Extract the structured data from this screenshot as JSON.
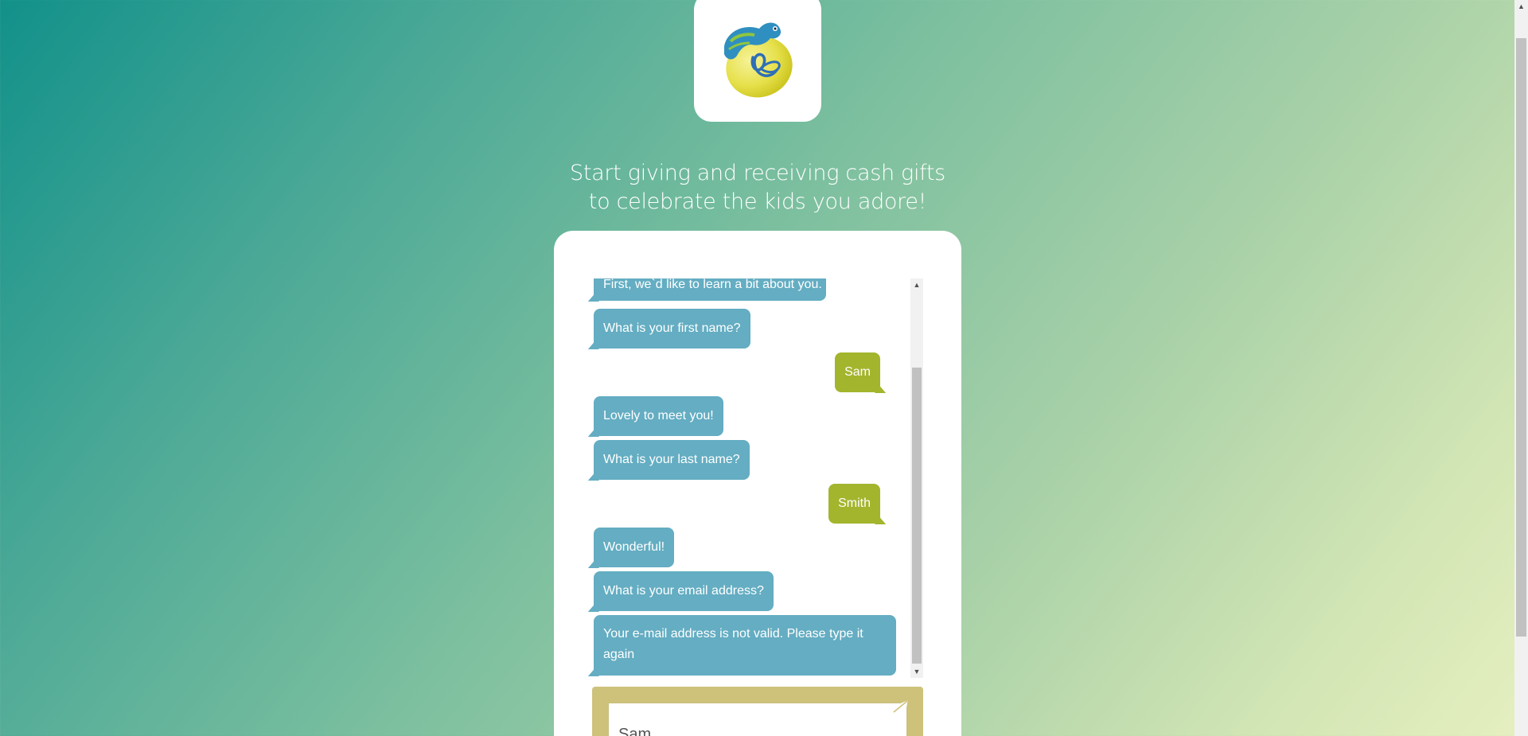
{
  "logo": {
    "icon": "chameleon-on-egg-logo"
  },
  "tagline": {
    "line1": "Start giving and receiving cash gifts",
    "line2": "to celebrate the kids you adore!"
  },
  "chat": {
    "messages": [
      {
        "from": "bot",
        "text": "First, we`d like to learn a bit about you."
      },
      {
        "from": "bot",
        "text": "What is your first name?"
      },
      {
        "from": "user",
        "text": "Sam"
      },
      {
        "from": "bot",
        "text": "Lovely to meet you!"
      },
      {
        "from": "bot",
        "text": "What is your last name?"
      },
      {
        "from": "user",
        "text": "Smith"
      },
      {
        "from": "bot",
        "text": "Wonderful!"
      },
      {
        "from": "bot",
        "text": "What is your email address?"
      },
      {
        "from": "bot",
        "text": "Your e-mail address is not valid. Please type it again"
      }
    ],
    "input": {
      "value": "Sam"
    },
    "send_icon": "paper-plane-icon"
  },
  "colors": {
    "bot_bubble": "#64adc2",
    "user_bubble": "#a3b52d",
    "input_bar": "#cec27a",
    "gradient_start": "#12918a",
    "gradient_end": "#e6efc0"
  }
}
